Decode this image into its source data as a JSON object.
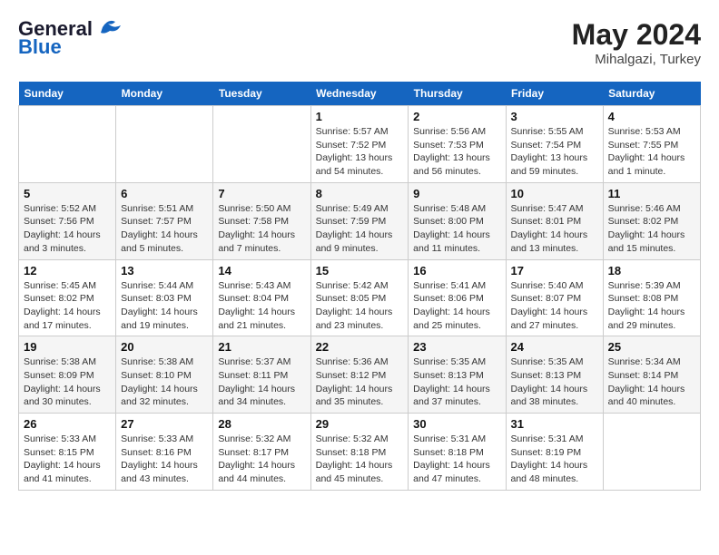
{
  "header": {
    "logo_text1": "General",
    "logo_text2": "Blue",
    "month": "May 2024",
    "location": "Mihalgazi, Turkey"
  },
  "weekdays": [
    "Sunday",
    "Monday",
    "Tuesday",
    "Wednesday",
    "Thursday",
    "Friday",
    "Saturday"
  ],
  "weeks": [
    [
      {
        "day": "",
        "info": ""
      },
      {
        "day": "",
        "info": ""
      },
      {
        "day": "",
        "info": ""
      },
      {
        "day": "1",
        "info": "Sunrise: 5:57 AM\nSunset: 7:52 PM\nDaylight: 13 hours\nand 54 minutes."
      },
      {
        "day": "2",
        "info": "Sunrise: 5:56 AM\nSunset: 7:53 PM\nDaylight: 13 hours\nand 56 minutes."
      },
      {
        "day": "3",
        "info": "Sunrise: 5:55 AM\nSunset: 7:54 PM\nDaylight: 13 hours\nand 59 minutes."
      },
      {
        "day": "4",
        "info": "Sunrise: 5:53 AM\nSunset: 7:55 PM\nDaylight: 14 hours\nand 1 minute."
      }
    ],
    [
      {
        "day": "5",
        "info": "Sunrise: 5:52 AM\nSunset: 7:56 PM\nDaylight: 14 hours\nand 3 minutes."
      },
      {
        "day": "6",
        "info": "Sunrise: 5:51 AM\nSunset: 7:57 PM\nDaylight: 14 hours\nand 5 minutes."
      },
      {
        "day": "7",
        "info": "Sunrise: 5:50 AM\nSunset: 7:58 PM\nDaylight: 14 hours\nand 7 minutes."
      },
      {
        "day": "8",
        "info": "Sunrise: 5:49 AM\nSunset: 7:59 PM\nDaylight: 14 hours\nand 9 minutes."
      },
      {
        "day": "9",
        "info": "Sunrise: 5:48 AM\nSunset: 8:00 PM\nDaylight: 14 hours\nand 11 minutes."
      },
      {
        "day": "10",
        "info": "Sunrise: 5:47 AM\nSunset: 8:01 PM\nDaylight: 14 hours\nand 13 minutes."
      },
      {
        "day": "11",
        "info": "Sunrise: 5:46 AM\nSunset: 8:02 PM\nDaylight: 14 hours\nand 15 minutes."
      }
    ],
    [
      {
        "day": "12",
        "info": "Sunrise: 5:45 AM\nSunset: 8:02 PM\nDaylight: 14 hours\nand 17 minutes."
      },
      {
        "day": "13",
        "info": "Sunrise: 5:44 AM\nSunset: 8:03 PM\nDaylight: 14 hours\nand 19 minutes."
      },
      {
        "day": "14",
        "info": "Sunrise: 5:43 AM\nSunset: 8:04 PM\nDaylight: 14 hours\nand 21 minutes."
      },
      {
        "day": "15",
        "info": "Sunrise: 5:42 AM\nSunset: 8:05 PM\nDaylight: 14 hours\nand 23 minutes."
      },
      {
        "day": "16",
        "info": "Sunrise: 5:41 AM\nSunset: 8:06 PM\nDaylight: 14 hours\nand 25 minutes."
      },
      {
        "day": "17",
        "info": "Sunrise: 5:40 AM\nSunset: 8:07 PM\nDaylight: 14 hours\nand 27 minutes."
      },
      {
        "day": "18",
        "info": "Sunrise: 5:39 AM\nSunset: 8:08 PM\nDaylight: 14 hours\nand 29 minutes."
      }
    ],
    [
      {
        "day": "19",
        "info": "Sunrise: 5:38 AM\nSunset: 8:09 PM\nDaylight: 14 hours\nand 30 minutes."
      },
      {
        "day": "20",
        "info": "Sunrise: 5:38 AM\nSunset: 8:10 PM\nDaylight: 14 hours\nand 32 minutes."
      },
      {
        "day": "21",
        "info": "Sunrise: 5:37 AM\nSunset: 8:11 PM\nDaylight: 14 hours\nand 34 minutes."
      },
      {
        "day": "22",
        "info": "Sunrise: 5:36 AM\nSunset: 8:12 PM\nDaylight: 14 hours\nand 35 minutes."
      },
      {
        "day": "23",
        "info": "Sunrise: 5:35 AM\nSunset: 8:13 PM\nDaylight: 14 hours\nand 37 minutes."
      },
      {
        "day": "24",
        "info": "Sunrise: 5:35 AM\nSunset: 8:13 PM\nDaylight: 14 hours\nand 38 minutes."
      },
      {
        "day": "25",
        "info": "Sunrise: 5:34 AM\nSunset: 8:14 PM\nDaylight: 14 hours\nand 40 minutes."
      }
    ],
    [
      {
        "day": "26",
        "info": "Sunrise: 5:33 AM\nSunset: 8:15 PM\nDaylight: 14 hours\nand 41 minutes."
      },
      {
        "day": "27",
        "info": "Sunrise: 5:33 AM\nSunset: 8:16 PM\nDaylight: 14 hours\nand 43 minutes."
      },
      {
        "day": "28",
        "info": "Sunrise: 5:32 AM\nSunset: 8:17 PM\nDaylight: 14 hours\nand 44 minutes."
      },
      {
        "day": "29",
        "info": "Sunrise: 5:32 AM\nSunset: 8:18 PM\nDaylight: 14 hours\nand 45 minutes."
      },
      {
        "day": "30",
        "info": "Sunrise: 5:31 AM\nSunset: 8:18 PM\nDaylight: 14 hours\nand 47 minutes."
      },
      {
        "day": "31",
        "info": "Sunrise: 5:31 AM\nSunset: 8:19 PM\nDaylight: 14 hours\nand 48 minutes."
      },
      {
        "day": "",
        "info": ""
      }
    ]
  ]
}
